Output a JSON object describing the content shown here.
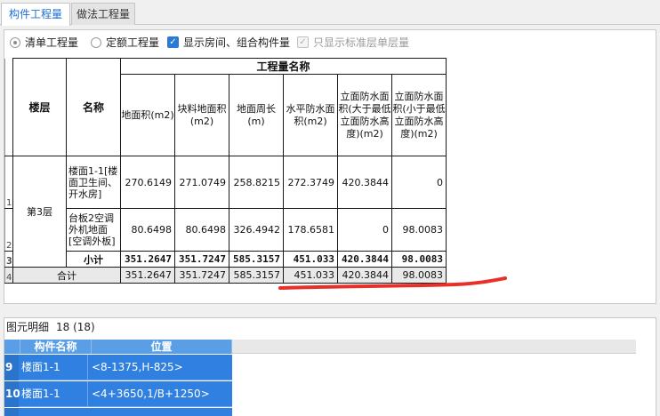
{
  "tabs": [
    {
      "label": "构件工程量",
      "active": true
    },
    {
      "label": "做法工程量",
      "active": false
    }
  ],
  "options": {
    "radio_bill": "清单工程量",
    "radio_quota": "定额工程量",
    "check_show_rooms": "显示房间、组合构件量",
    "check_standard_floor": "只显示标准层单层量",
    "selected_radio": "清单工程量",
    "show_rooms_checked": true,
    "standard_floor_checked": true,
    "standard_floor_disabled": true
  },
  "table": {
    "header": {
      "floor": "楼层",
      "name": "名称",
      "group": "工程量名称",
      "columns": [
        "地面积(m2)",
        "块料地面积(m2)",
        "地面周长(m)",
        "水平防水面积(m2)",
        "立面防水面积(大于最低立面防水高度)(m2)",
        "立面防水面积(小于最低立面防水高度)(m2)"
      ]
    },
    "row_numbers": [
      "1",
      "2",
      "3",
      "4"
    ],
    "floor_value": "第3层",
    "rows": [
      {
        "name": "楼面1-1[楼面卫生间、开水房]",
        "values": [
          "270.6149",
          "271.0749",
          "258.8215",
          "272.3749",
          "420.3844",
          "0"
        ]
      },
      {
        "name": "台板2空调外机地面[空调外板]",
        "values": [
          "80.6498",
          "80.6498",
          "326.4942",
          "178.6581",
          "0",
          "98.0083"
        ]
      }
    ],
    "subtotal": {
      "label": "小计",
      "values": [
        "351.2647",
        "351.7247",
        "585.3157",
        "451.033",
        "420.3844",
        "98.0083"
      ]
    },
    "total": {
      "label": "合计",
      "values": [
        "351.2647",
        "351.7247",
        "585.3157",
        "451.033",
        "420.3844",
        "98.0083"
      ]
    }
  },
  "detail": {
    "title": "图元明细",
    "count": "18 (18)",
    "columns": [
      "构件名称",
      "位置"
    ],
    "rows": [
      {
        "index": "9",
        "name": "楼面1-1",
        "position": "<8-1375,H-825>"
      },
      {
        "index": "10",
        "name": "楼面1-1",
        "position": "<4+3650,1/B+1250>"
      }
    ]
  },
  "colors": {
    "accent": "#1e6fd8",
    "selection": "#2f80e0",
    "annotation": "#e8302a"
  }
}
